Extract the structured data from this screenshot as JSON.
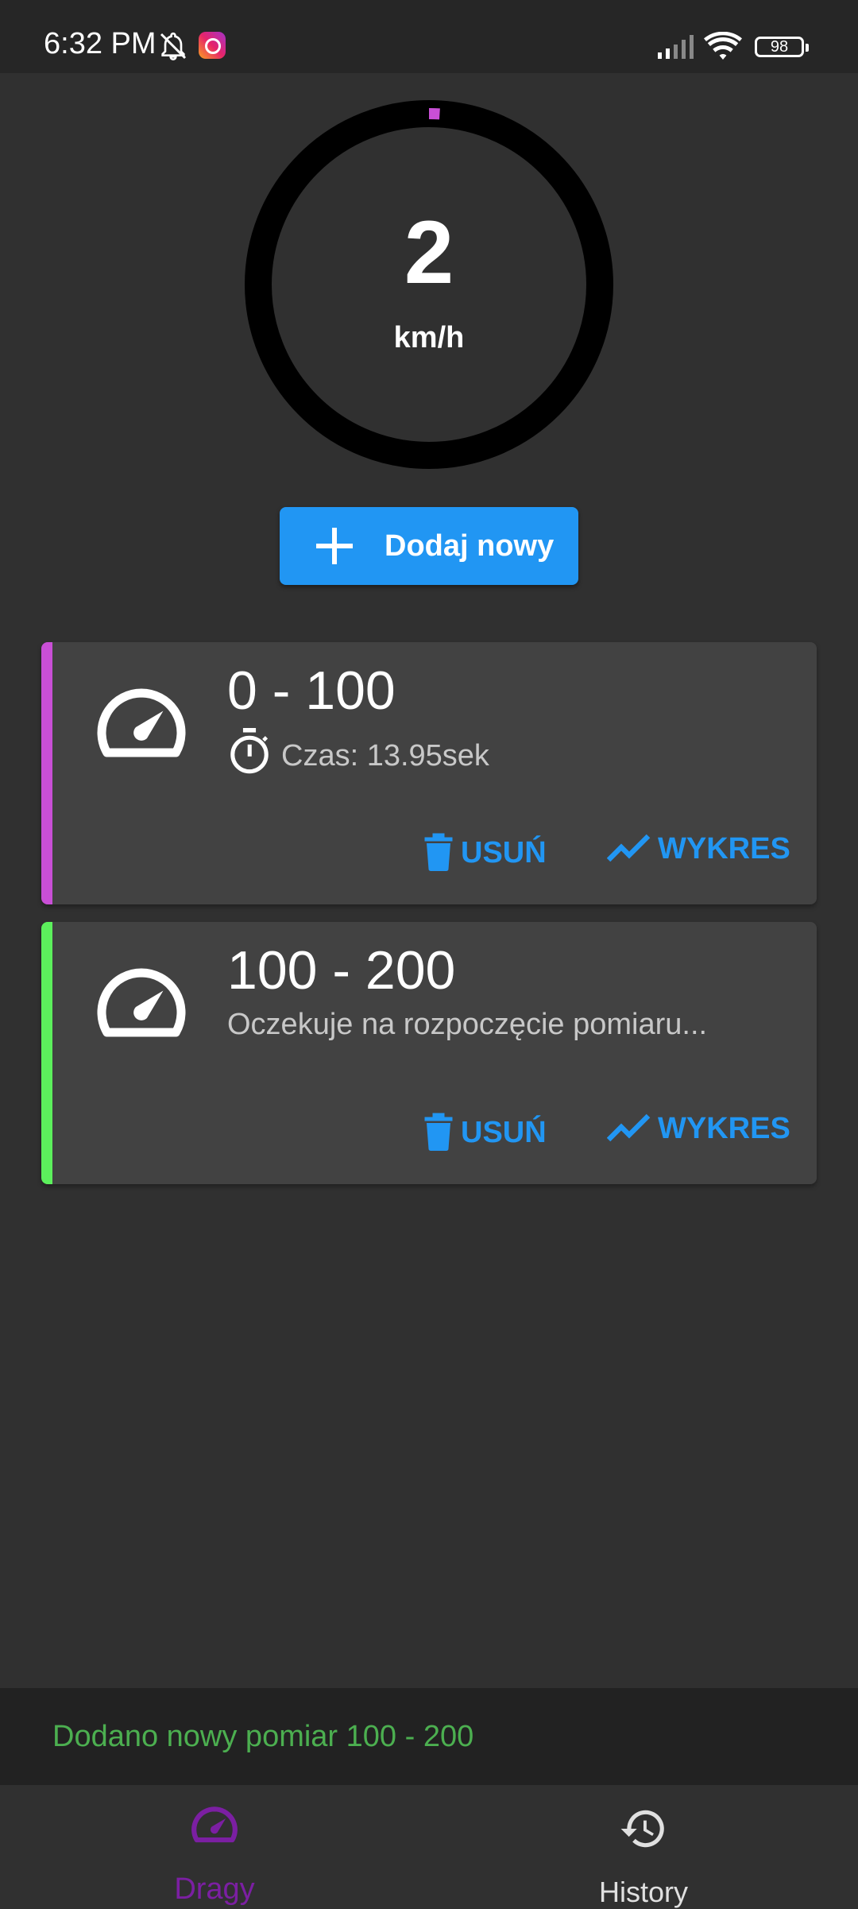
{
  "status_bar": {
    "time": "6:32 PM",
    "battery": "98",
    "icons": [
      "bell-off-icon",
      "instagram-icon",
      "signal-icon",
      "wifi-icon",
      "battery-icon"
    ]
  },
  "speedometer": {
    "value": "2",
    "unit": "km/h",
    "progress_fraction": 0.01,
    "track_color": "#000000",
    "progress_color": "#c94fd6"
  },
  "add_button": {
    "label": "Dodaj nowy",
    "icon": "plus-icon",
    "color": "#2196f3"
  },
  "measurements": [
    {
      "title": "0 - 100",
      "status": "Czas: 13.95sek",
      "has_timer_icon": true,
      "accent_color": "#c94fd6",
      "delete_label": "USUŃ",
      "chart_label": "WYKRES"
    },
    {
      "title": "100 - 200",
      "status": "Oczekuje na rozpoczęcie pomiaru...",
      "has_timer_icon": false,
      "accent_color": "#5cf05c",
      "delete_label": "USUŃ",
      "chart_label": "WYKRES"
    }
  ],
  "snackbar": {
    "message": "Dodano nowy pomiar 100 - 200",
    "color": "#4caf50"
  },
  "bottom_nav": {
    "items": [
      {
        "label": "Dragy",
        "icon": "speedometer-icon",
        "active": true,
        "color": "#7b1fa2"
      },
      {
        "label": "History",
        "icon": "history-icon",
        "active": false,
        "color": "#e0e0e0"
      }
    ]
  }
}
